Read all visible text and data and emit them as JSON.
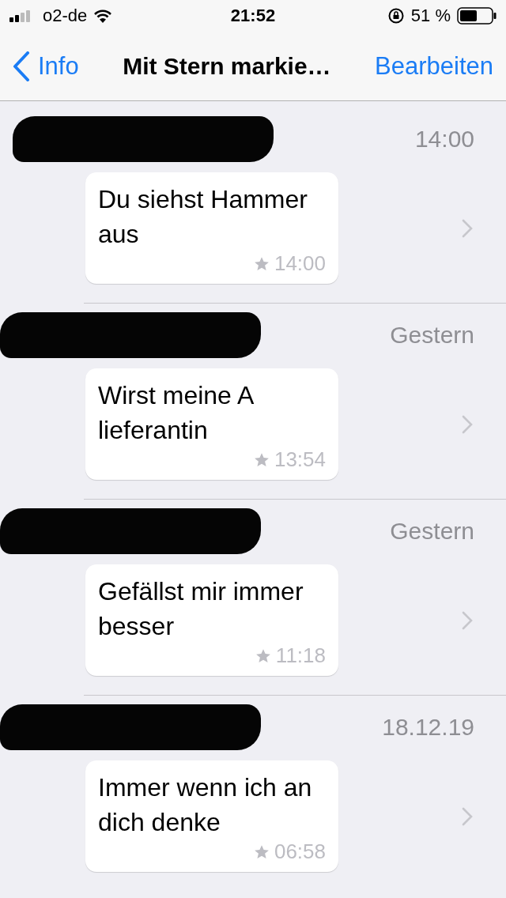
{
  "status_bar": {
    "carrier": "o2-de",
    "time": "21:52",
    "battery": "51 %"
  },
  "nav": {
    "back": "Info",
    "title": "Mit Stern markie…",
    "action": "Bearbeiten"
  },
  "messages": [
    {
      "date": "14:00",
      "text": "Du siehst Hammer aus",
      "time": "14:00",
      "starred": true
    },
    {
      "date": "Gestern",
      "text": "Wirst meine A lieferantin",
      "time": "13:54",
      "starred": true
    },
    {
      "date": "Gestern",
      "text": "Gefällst mir immer besser",
      "time": "11:18",
      "starred": true
    },
    {
      "date": "18.12.19",
      "text": "Immer wenn ich an dich denke",
      "time": "06:58",
      "starred": true
    }
  ]
}
